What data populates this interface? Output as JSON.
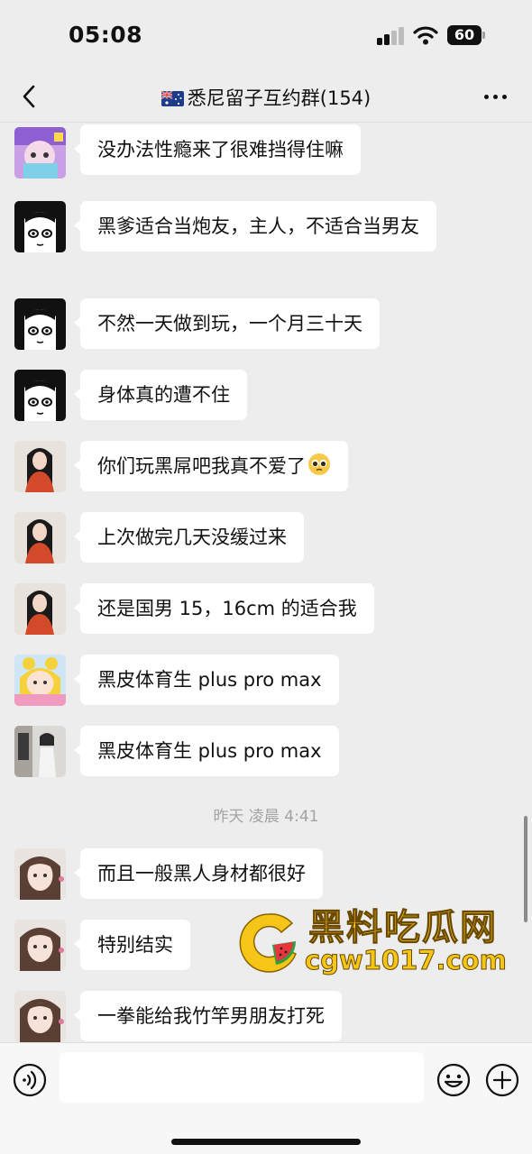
{
  "status_bar": {
    "time": "05:08",
    "battery": "60",
    "icons": [
      "signal-icon",
      "wifi-icon",
      "battery-icon"
    ]
  },
  "nav": {
    "title": "悉尼留子互约群(154)",
    "flag": "australia-flag-icon",
    "back_icon": "chevron-left-icon",
    "more_icon": "more-icon"
  },
  "messages": [
    {
      "avatar": "anime-avatar-icon",
      "text": "没办法性瘾来了很难挡得住嘛"
    },
    {
      "avatar": "manga-girl-avatar-icon",
      "text": "黑爹适合当炮友，主人，不适合当男友"
    },
    {
      "avatar": "manga-girl-avatar-icon",
      "text": "不然一天做到玩，一个月三十天"
    },
    {
      "avatar": "manga-girl-avatar-icon",
      "text": "身体真的遭不住"
    },
    {
      "avatar": "photo-avatar-icon",
      "text": "你们玩黑屌吧我真不爱了",
      "emoji": "pleading-face-emoji"
    },
    {
      "avatar": "photo-avatar-icon",
      "text": "上次做完几天没缓过来"
    },
    {
      "avatar": "photo-avatar-icon",
      "text": "还是国男 15，16cm 的适合我"
    },
    {
      "avatar": "sailor-moon-avatar-icon",
      "text": "黑皮体育生 plus pro max"
    },
    {
      "avatar": "mirror-selfie-avatar-icon",
      "text": "黑皮体育生 plus pro max"
    },
    {
      "avatar": "selfie-avatar-icon",
      "text": "而且一般黑人身材都很好"
    },
    {
      "avatar": "selfie-avatar-icon",
      "text": "特别结实"
    },
    {
      "avatar": "selfie-avatar-icon",
      "text": "一拳能给我竹竿男朋友打死"
    }
  ],
  "timestamp": "昨天 凌晨 4:41",
  "watermark": {
    "title": "黑料吃瓜网",
    "url": "cgw1017.com"
  },
  "input_bar": {
    "placeholder": "",
    "icons": [
      "voice-icon",
      "emoji-icon",
      "plus-icon"
    ]
  },
  "colors": {
    "background": "#ededed",
    "bubble": "#ffffff",
    "watermark": "#f5c518"
  }
}
